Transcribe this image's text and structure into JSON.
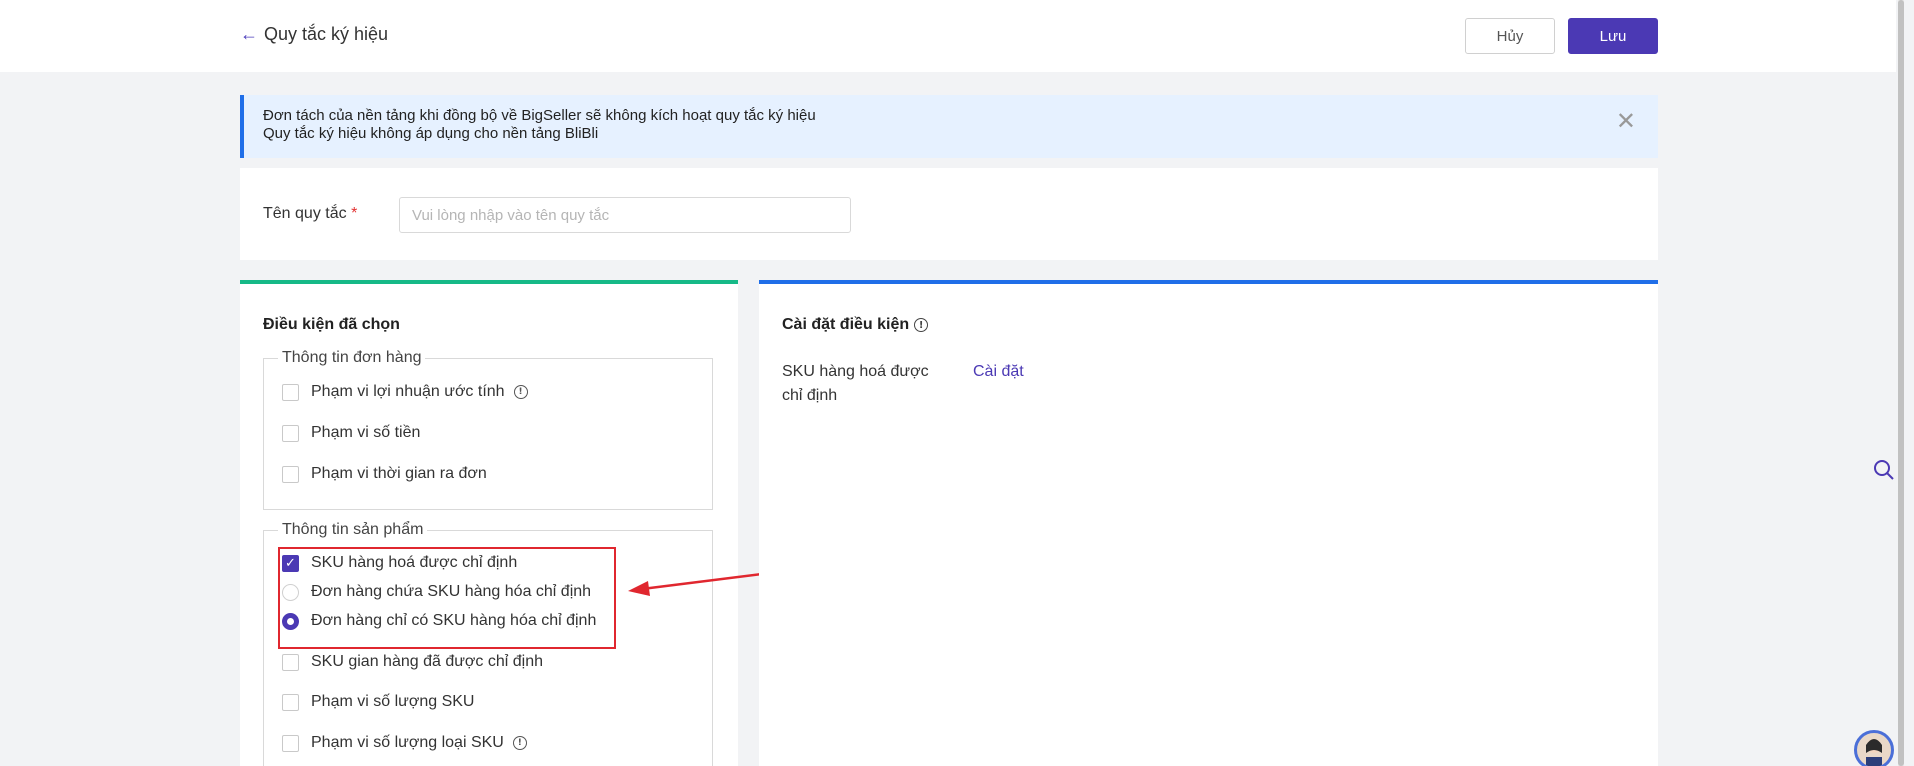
{
  "header": {
    "back_label": "Quy tắc ký hiệu",
    "cancel_label": "Hủy",
    "save_label": "Lưu"
  },
  "notice": {
    "line1": "Đơn tách của nền tảng khi đồng bộ về BigSeller sẽ không kích hoạt quy tắc ký hiệu",
    "line2": "Quy tắc ký hiệu không áp dụng cho nền tảng BliBli",
    "close": "✕"
  },
  "rule_name": {
    "label": "Tên quy tắc",
    "required_mark": "*",
    "placeholder": "Vui lòng nhập vào tên quy tắc",
    "value": ""
  },
  "selected_conditions": {
    "title": "Điều kiện đã chọn",
    "order_group": {
      "legend": "Thông tin đơn hàng",
      "options": [
        {
          "label": "Phạm vi lợi nhuận ước tính",
          "checked": false
        },
        {
          "label": "Phạm vi số tiền",
          "checked": false
        },
        {
          "label": "Phạm vi thời gian ra đơn",
          "checked": false
        }
      ]
    },
    "product_group": {
      "legend": "Thông tin sản phẩm",
      "sku_option": {
        "label": "SKU hàng hoá được chỉ định",
        "checked": true
      },
      "radios": [
        {
          "label": "Đơn hàng chứa SKU hàng hóa chỉ định",
          "selected": false
        },
        {
          "label": "Đơn hàng chỉ có SKU hàng hóa chỉ định",
          "selected": true
        }
      ],
      "options": [
        {
          "label": "SKU gian hàng đã được chỉ định",
          "checked": false
        },
        {
          "label": "Phạm vi số lượng SKU",
          "checked": false
        },
        {
          "label": "Phạm vi số lượng loại SKU",
          "checked": false
        }
      ]
    }
  },
  "condition_settings": {
    "title": "Cài đặt điều kiện",
    "item_label": "SKU hàng hoá được chỉ định",
    "item_action": "Cài đặt"
  },
  "colors": {
    "brand": "#4b39b4",
    "green_accent": "#16b987",
    "blue_accent": "#1f6ee8",
    "highlight_red": "#e0272f"
  }
}
